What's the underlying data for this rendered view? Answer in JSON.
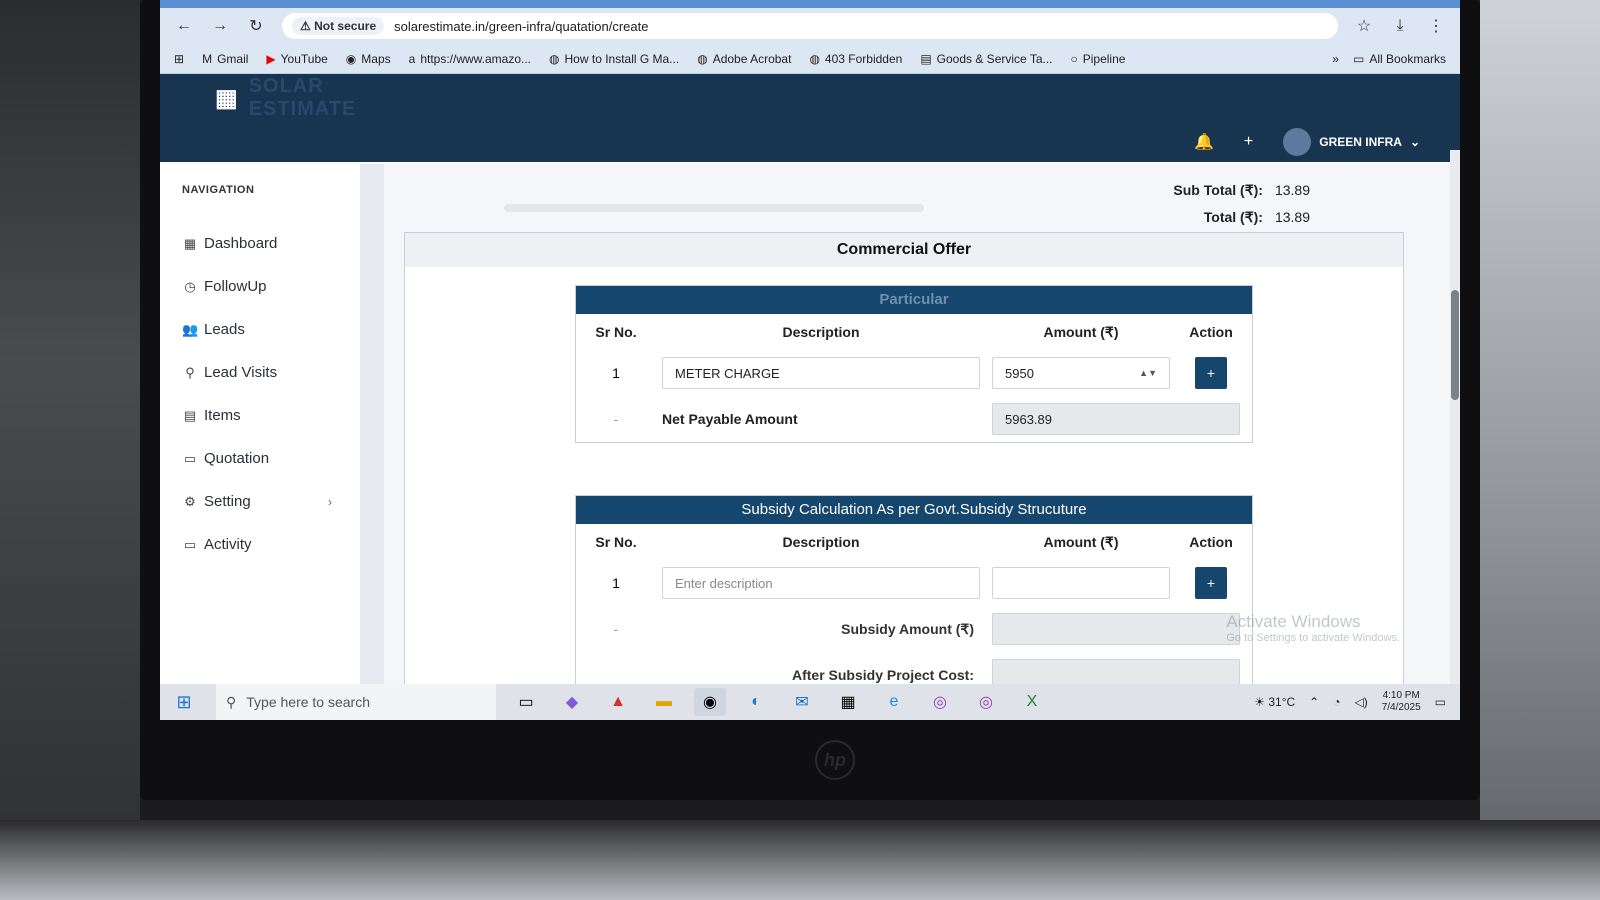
{
  "browser": {
    "insecure_label": "Not secure",
    "url": "solarestimate.in/green-infra/quatation/create",
    "bookmarks": [
      "Gmail",
      "YouTube",
      "Maps",
      "https://www.amazo...",
      "How to Install G Ma...",
      "Adobe Acrobat",
      "403 Forbidden",
      "Goods & Service Ta...",
      "Pipeline"
    ],
    "all_bookmarks": "All Bookmarks"
  },
  "app": {
    "brand": "SOLAR ESTIMATE",
    "user": "GREEN INFRA"
  },
  "sidebar": {
    "title": "NAVIGATION",
    "items": [
      {
        "label": "Dashboard",
        "icon": "dashboard-icon"
      },
      {
        "label": "FollowUp",
        "icon": "clock-icon"
      },
      {
        "label": "Leads",
        "icon": "users-icon"
      },
      {
        "label": "Lead Visits",
        "icon": "map-pin-icon"
      },
      {
        "label": "Items",
        "icon": "grid-icon"
      },
      {
        "label": "Quotation",
        "icon": "document-icon"
      },
      {
        "label": "Setting",
        "icon": "gear-icon"
      },
      {
        "label": "Activity",
        "icon": "activity-icon"
      }
    ]
  },
  "totals": {
    "subtotal_label": "Sub Total (₹):",
    "subtotal_value": "13.89",
    "total_label": "Total (₹):",
    "total_value": "13.89"
  },
  "offer": {
    "title": "Commercial Offer",
    "particular": {
      "heading": "Particular",
      "cols": [
        "Sr No.",
        "Description",
        "Amount (₹)",
        "Action"
      ],
      "row": {
        "sr": "1",
        "description": "METER CHARGE",
        "amount": "5950",
        "action": "+"
      },
      "net_sr": "-",
      "net_label": "Net Payable Amount",
      "net_value": "5963.89"
    },
    "subsidy": {
      "heading": "Subsidy Calculation As per Govt.Subsidy Strucuture",
      "cols": [
        "Sr No.",
        "Description",
        "Amount (₹)",
        "Action"
      ],
      "row": {
        "sr": "1",
        "description_placeholder": "Enter description",
        "action": "+"
      },
      "subsidy_sr": "-",
      "subsidy_label": "Subsidy Amount (₹)",
      "after_label": "After Subsidy Project Cost:"
    }
  },
  "watermark": {
    "title": "Activate Windows",
    "sub": "Go to Settings to activate Windows."
  },
  "taskbar": {
    "search_placeholder": "Type here to search",
    "weather": "31°C",
    "time": "4:10 PM",
    "date": "7/4/2025"
  }
}
